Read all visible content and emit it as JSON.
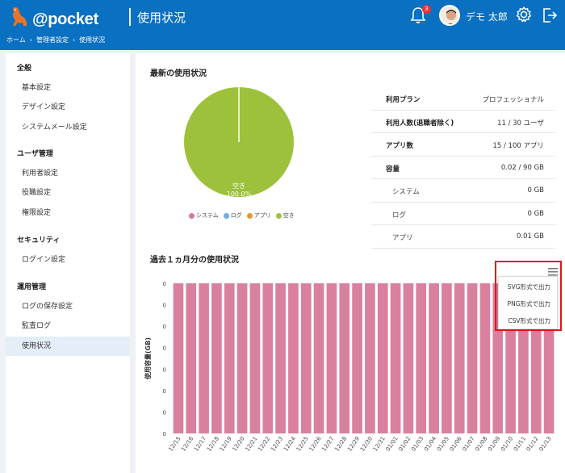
{
  "header": {
    "app_name": "@pocket",
    "page_title": "使用状況",
    "breadcrumb": [
      "ホーム",
      "管理者設定",
      "使用状況"
    ],
    "breadcrumb_sep": "›",
    "notification_count": "3",
    "user_name": "デモ 太郎",
    "bg_color": "#0a70c2"
  },
  "sidebar": {
    "groups": [
      {
        "label": "全般",
        "items": [
          "基本設定",
          "デザイン設定",
          "システムメール設定"
        ]
      },
      {
        "label": "ユーザ管理",
        "items": [
          "利用者設定",
          "役職設定",
          "権限設定"
        ]
      },
      {
        "label": "セキュリティ",
        "items": [
          "ログイン設定"
        ]
      },
      {
        "label": "運用管理",
        "items": [
          "ログの保存設定",
          "監査ログ",
          "使用状況"
        ]
      }
    ],
    "active_item": "使用状況"
  },
  "latest": {
    "title": "最新の使用状況",
    "pie_label": "空き",
    "pie_value": "100.0%",
    "legend": [
      {
        "label": "システム",
        "color": "#d9779a"
      },
      {
        "label": "ログ",
        "color": "#6aaee3"
      },
      {
        "label": "アプリ",
        "color": "#e39a2e"
      },
      {
        "label": "空き",
        "color": "#9dc13a"
      }
    ],
    "table": [
      {
        "label": "利用プラン",
        "value": "プロフェッショナル",
        "sub": false
      },
      {
        "label": "利用人数(退職者除く)",
        "value": "11 / 30 ユーザ",
        "sub": false
      },
      {
        "label": "アプリ数",
        "value": "15 / 100 アプリ",
        "sub": false
      },
      {
        "label": "容量",
        "value": "0.02 / 90 GB",
        "sub": false
      },
      {
        "label": "システム",
        "value": "0 GB",
        "sub": true
      },
      {
        "label": "ログ",
        "value": "0 GB",
        "sub": true
      },
      {
        "label": "アプリ",
        "value": "0.01 GB",
        "sub": true
      }
    ]
  },
  "monthly": {
    "title": "過去１ヵ月分の使用状況",
    "export_menu": [
      "SVG形式で出力",
      "PNG形式で出力",
      "CSV形式で出力"
    ]
  },
  "chart_data": [
    {
      "type": "pie",
      "categories": [
        "システム",
        "ログ",
        "アプリ",
        "空き"
      ],
      "values": [
        0,
        0,
        0,
        100
      ],
      "data_label": "空き 100.0%",
      "colors": [
        "#d9779a",
        "#6aaee3",
        "#e39a2e",
        "#9dc13a"
      ],
      "legend": "bottom"
    },
    {
      "type": "bar",
      "categories": [
        "12/15",
        "12/16",
        "12/17",
        "12/18",
        "12/19",
        "12/20",
        "12/21",
        "12/22",
        "12/23",
        "12/24",
        "12/25",
        "12/26",
        "12/27",
        "12/28",
        "12/29",
        "12/30",
        "12/31",
        "01/01",
        "01/02",
        "01/03",
        "01/04",
        "01/05",
        "01/06",
        "01/07",
        "01/08",
        "01/09",
        "01/10",
        "01/11",
        "01/12",
        "01/13"
      ],
      "series": [
        {
          "values": [
            0.02,
            0.02,
            0.02,
            0.02,
            0.02,
            0.02,
            0.02,
            0.02,
            0.02,
            0.02,
            0.02,
            0.02,
            0.02,
            0.02,
            0.02,
            0.02,
            0.02,
            0.02,
            0.02,
            0.02,
            0.02,
            0.02,
            0.02,
            0.02,
            0.02,
            0.02,
            0.02,
            0.02,
            0.02,
            0.02
          ],
          "color": "#d9809e"
        }
      ],
      "ylabel": "使用容量(GB)",
      "y_ticks": [
        "0",
        "0",
        "0",
        "0",
        "0",
        "0",
        "0",
        "0"
      ],
      "ylim": [
        0,
        0.02
      ],
      "grid": false
    }
  ]
}
